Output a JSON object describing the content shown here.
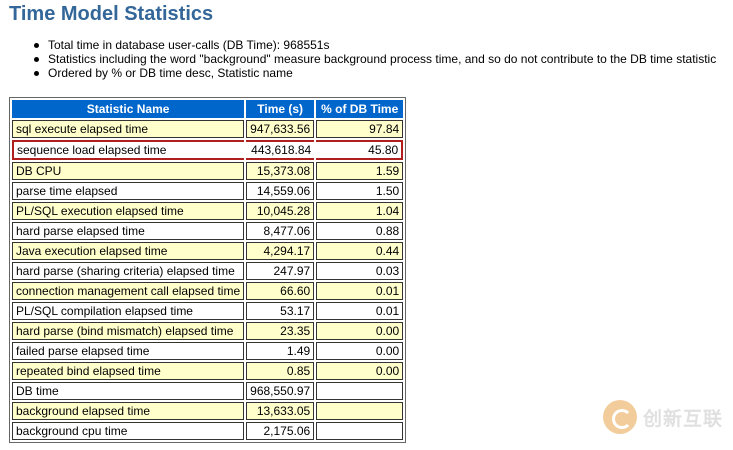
{
  "title": "Time Model Statistics",
  "notes": [
    "Total time in database user-calls (DB Time): 968551s",
    "Statistics including the word \"background\" measure background process time, and so do not contribute to the DB time statistic",
    "Ordered by % or DB time desc, Statistic name"
  ],
  "table": {
    "headers": [
      "Statistic Name",
      "Time (s)",
      "% of DB Time"
    ],
    "rows": [
      {
        "name": "sql execute elapsed time",
        "time": "947,633.56",
        "pct": "97.84"
      },
      {
        "name": "sequence load elapsed time",
        "time": "443,618.84",
        "pct": "45.80"
      },
      {
        "name": "DB CPU",
        "time": "15,373.08",
        "pct": "1.59"
      },
      {
        "name": "parse time elapsed",
        "time": "14,559.06",
        "pct": "1.50"
      },
      {
        "name": "PL/SQL execution elapsed time",
        "time": "10,045.28",
        "pct": "1.04"
      },
      {
        "name": "hard parse elapsed time",
        "time": "8,477.06",
        "pct": "0.88"
      },
      {
        "name": "Java execution elapsed time",
        "time": "4,294.17",
        "pct": "0.44"
      },
      {
        "name": "hard parse (sharing criteria) elapsed time",
        "time": "247.97",
        "pct": "0.03"
      },
      {
        "name": "connection management call elapsed time",
        "time": "66.60",
        "pct": "0.01"
      },
      {
        "name": "PL/SQL compilation elapsed time",
        "time": "53.17",
        "pct": "0.01"
      },
      {
        "name": "hard parse (bind mismatch) elapsed time",
        "time": "23.35",
        "pct": "0.00"
      },
      {
        "name": "failed parse elapsed time",
        "time": "1.49",
        "pct": "0.00"
      },
      {
        "name": "repeated bind elapsed time",
        "time": "0.85",
        "pct": "0.00"
      },
      {
        "name": "DB time",
        "time": "968,550.97",
        "pct": ""
      },
      {
        "name": "background elapsed time",
        "time": "13,633.05",
        "pct": ""
      },
      {
        "name": "background cpu time",
        "time": "2,175.06",
        "pct": ""
      }
    ]
  },
  "highlighted_row": "sequence load elapsed time",
  "watermark": {
    "text": "创新互联",
    "logo": "cdcxhl-logo-icon"
  }
}
